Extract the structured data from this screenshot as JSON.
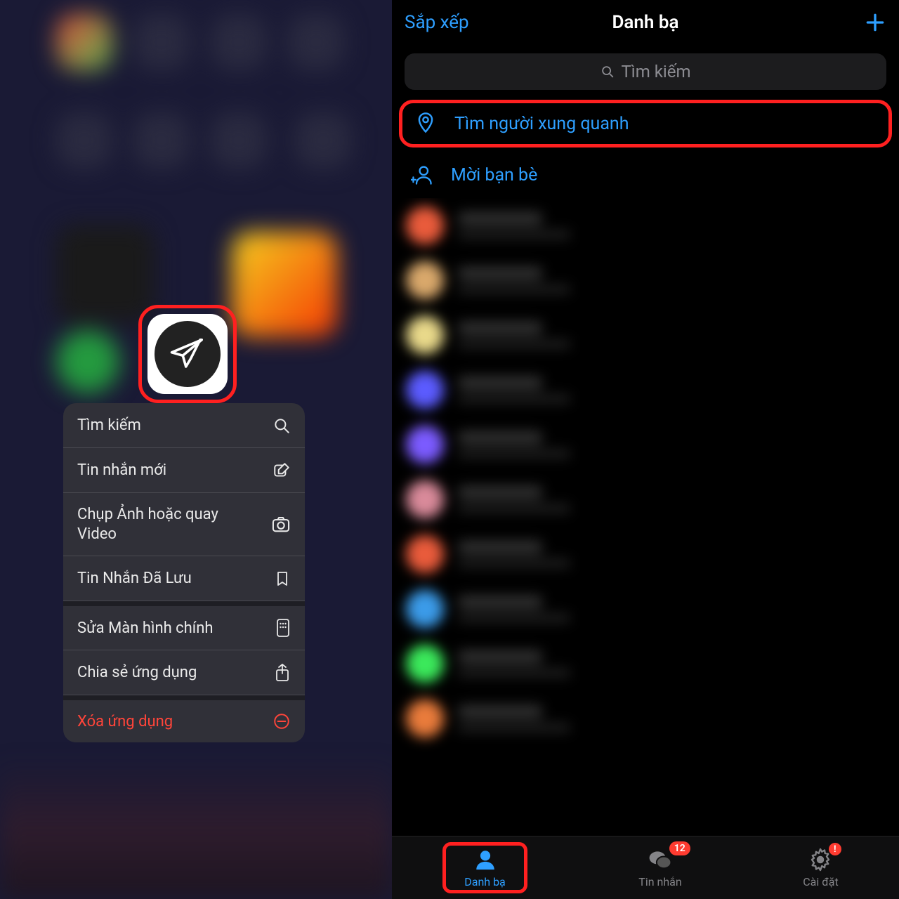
{
  "contextMenu": {
    "items": [
      {
        "label": "Tìm kiếm",
        "icon": "search"
      },
      {
        "label": "Tin nhắn mới",
        "icon": "compose"
      },
      {
        "label": "Chụp Ảnh hoặc quay Video",
        "icon": "camera"
      },
      {
        "label": "Tin Nhắn Đã Lưu",
        "icon": "bookmark"
      },
      {
        "label": "Sửa Màn hình chính",
        "icon": "phone-edit"
      },
      {
        "label": "Chia sẻ ứng dụng",
        "icon": "share"
      },
      {
        "label": "Xóa ứng dụng",
        "icon": "remove"
      }
    ]
  },
  "contacts": {
    "header": {
      "sort": "Sắp xếp",
      "title": "Danh bạ"
    },
    "search_placeholder": "Tìm kiếm",
    "actions": {
      "nearby": "Tìm người xung quanh",
      "invite": "Mời bạn bè"
    },
    "avatar_colors": [
      "#e95b3b",
      "#d9a86b",
      "#e9d98a",
      "#5b5bff",
      "#7b5bff",
      "#d98a9a",
      "#e95b3b",
      "#3b9be9",
      "#3be95b",
      "#e97b3b"
    ]
  },
  "tabs": {
    "contacts": "Danh bạ",
    "messages": "Tin nhắn",
    "messages_badge": "12",
    "settings": "Cài đặt",
    "settings_badge": "!"
  }
}
